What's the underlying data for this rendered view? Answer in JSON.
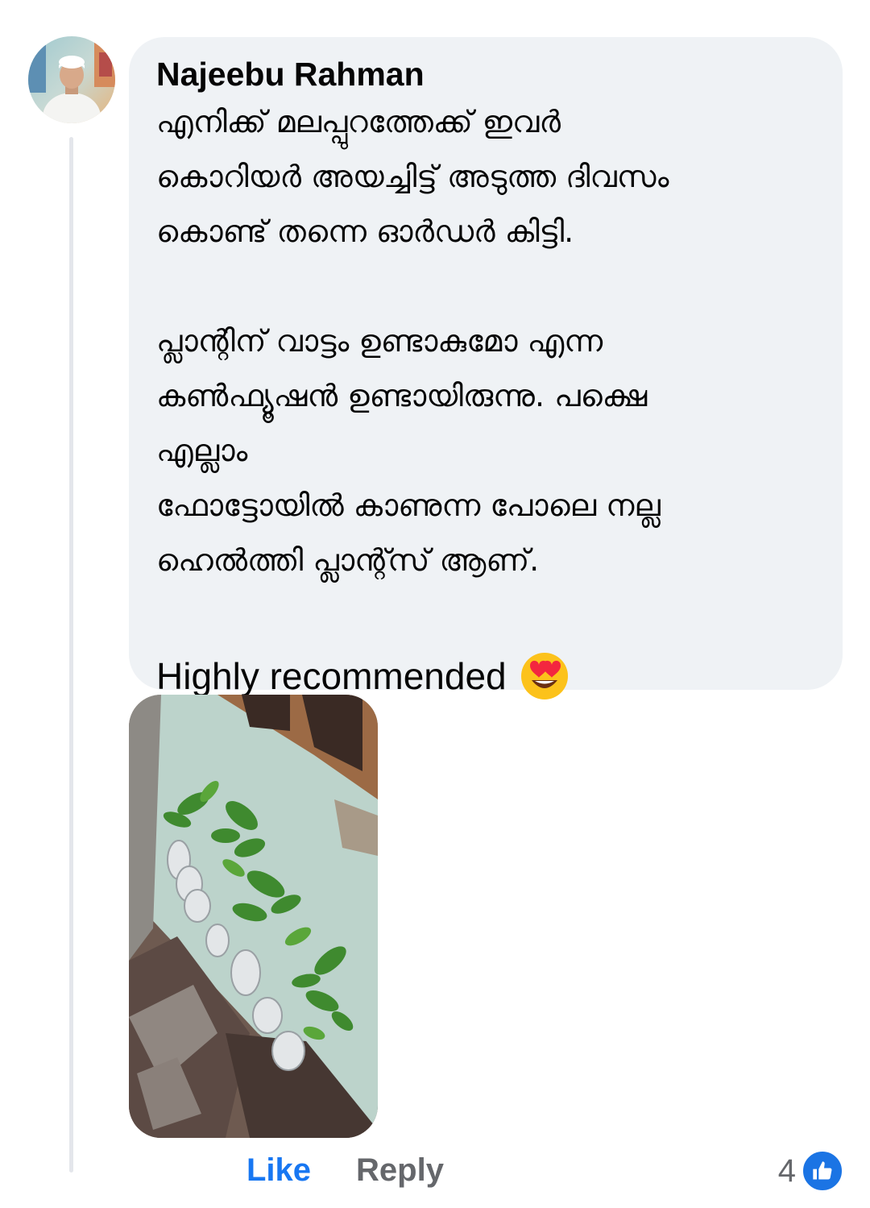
{
  "comment": {
    "author": "Najeebu Rahman",
    "paragraph_1": [
      "എനിക്ക് മലപ്പുറത്തേക്ക് ഇവർ",
      "കൊറിയർ അയച്ചിട്ട് അടുത്ത ദിവസം",
      "കൊണ്ട് തന്നെ ഓർഡർ കിട്ടി."
    ],
    "paragraph_2": [
      "പ്ലാന്റിന് വാട്ടം ഉണ്ടാകുമോ എന്ന",
      "കൺഫ്യൂഷൻ ഉണ്ടായിരുന്നു. പക്ഷെ",
      "എല്ലാം",
      "ഫോട്ടോയിൽ കാണുന്ന പോലെ നല്ല",
      "ഹെൽത്തി പ്ലാന്റ്സ് ആണ്."
    ],
    "closing": "Highly recommended",
    "closing_emoji": "heart-eyes-emoji",
    "attachment_icon": "photo-attachment"
  },
  "actions": {
    "like_label": "Like",
    "reply_label": "Reply"
  },
  "reactions": {
    "count": "4",
    "icon": "thumbs-up-icon",
    "color": "#1b74e4"
  },
  "colors": {
    "bubble": "#eff2f5",
    "like_active": "#1877f2",
    "muted": "#65676b"
  }
}
